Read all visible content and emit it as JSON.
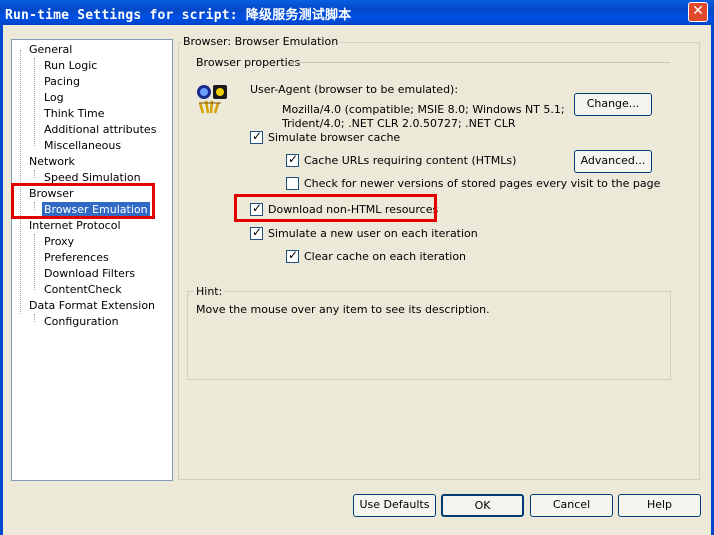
{
  "window": {
    "title": "Run-time Settings for script: 降级服务测试脚本",
    "close_glyph": "✕"
  },
  "tree": {
    "items": [
      {
        "label": "General"
      },
      {
        "label": "Run Logic"
      },
      {
        "label": "Pacing"
      },
      {
        "label": "Log"
      },
      {
        "label": "Think Time"
      },
      {
        "label": "Additional attributes"
      },
      {
        "label": "Miscellaneous"
      },
      {
        "label": "Network"
      },
      {
        "label": "Speed Simulation"
      },
      {
        "label": "Browser"
      },
      {
        "label": "Browser Emulation"
      },
      {
        "label": "Internet Protocol"
      },
      {
        "label": "Proxy"
      },
      {
        "label": "Preferences"
      },
      {
        "label": "Download Filters"
      },
      {
        "label": "ContentCheck"
      },
      {
        "label": "Data Format Extension"
      },
      {
        "label": "Configuration"
      }
    ],
    "selected": "Browser Emulation"
  },
  "panel": {
    "group_title": "Browser: Browser Emulation",
    "section_title": "Browser properties",
    "user_agent_label": "User-Agent (browser to be emulated):",
    "user_agent_line1": "Mozilla/4.0 (compatible; MSIE 8.0; Windows NT 5.1;",
    "user_agent_line2": "Trident/4.0; .NET CLR 2.0.50727; .NET CLR",
    "change_button": "Change...",
    "advanced_button": "Advanced...",
    "options": {
      "simulate_cache": {
        "label": "Simulate browser cache",
        "checked": true
      },
      "cache_urls": {
        "label": "Cache URLs requiring content (HTMLs)",
        "checked": true
      },
      "check_newer": {
        "label": "Check for newer versions of stored pages every visit to the page",
        "checked": false
      },
      "download_non_html": {
        "label": "Download non-HTML resources",
        "checked": true
      },
      "simulate_new_user": {
        "label": "Simulate a new user on each iteration",
        "checked": true
      },
      "clear_cache": {
        "label": "Clear cache on each iteration",
        "checked": true
      }
    },
    "hint_title": "Hint:",
    "hint_text": "Move the mouse over any item to see its description."
  },
  "footer": {
    "use_defaults": "Use Defaults",
    "ok": "OK",
    "cancel": "Cancel",
    "help": "Help"
  },
  "colors": {
    "highlight": "#e00000",
    "selection": "#316ac5",
    "titlebar": "#0050e6"
  }
}
